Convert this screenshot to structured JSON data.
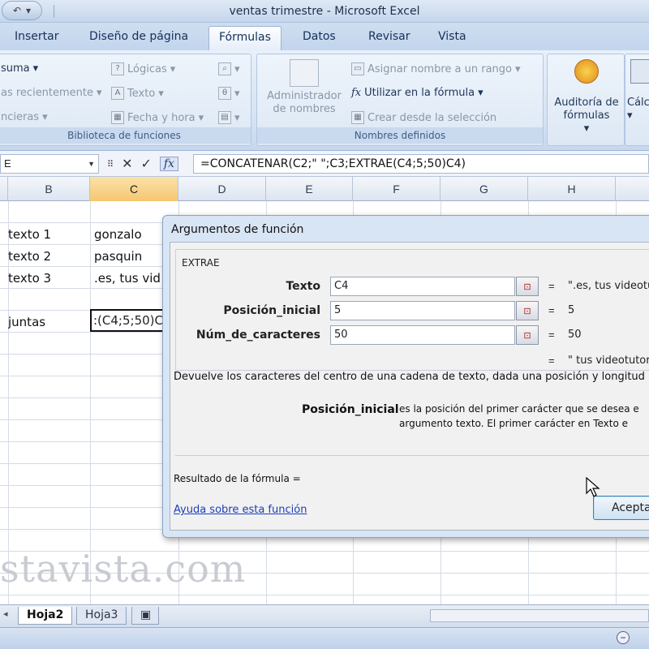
{
  "window": {
    "title": "ventas trimestre - Microsoft Excel"
  },
  "ribbon_tabs": [
    "Insertar",
    "Diseño de página",
    "Fórmulas",
    "Datos",
    "Revisar",
    "Vista"
  ],
  "ribbon": {
    "biblioteca": {
      "items_left": [
        "suma",
        "as recientemente",
        "ncieras"
      ],
      "items_mid": [
        "Lógicas",
        "Texto",
        "Fecha y hora"
      ],
      "label": "Biblioteca de funciones"
    },
    "nombres": {
      "admin": "Administrador de nombres",
      "asignar": "Asignar nombre a un rango",
      "utilizar": "Utilizar en la fórmula",
      "crear": "Crear desde la selección",
      "label": "Nombres definidos"
    },
    "auditoria": "Auditoría de fórmulas",
    "calculo": "Cálc"
  },
  "formula_bar": {
    "name_box": "E",
    "formula": "=CONCATENAR(C2;\" \";C3;EXTRAE(C4;5;50)C4)"
  },
  "columns": [
    "B",
    "C",
    "D",
    "E",
    "F",
    "G",
    "H"
  ],
  "cells": {
    "b2": "texto 1",
    "c2": "gonzalo",
    "b3": "texto 2",
    "c3": "pasquin",
    "b4": "texto 3",
    "c4": ".es, tus vid",
    "b6": "juntas",
    "c6": ":(C4;5;50)C"
  },
  "watermark": "stavista.com",
  "sheet_tabs": [
    "Hoja2",
    "Hoja3"
  ],
  "dialog": {
    "title": "Argumentos de función",
    "function_name": "EXTRAE",
    "args": [
      {
        "label": "Texto",
        "value": "C4",
        "result": "\".es, tus videotuto"
      },
      {
        "label": "Posición_inicial",
        "value": "5",
        "result": "5"
      },
      {
        "label": "Núm_de_caracteres",
        "value": "50",
        "result": "50"
      }
    ],
    "overall_result": "\" tus videotutoria",
    "description": "Devuelve los caracteres del centro de una cadena de texto, dada una posición y longitud i",
    "param_name": "Posición_inicial",
    "param_desc_1": "es la posición del primer carácter que se desea e",
    "param_desc_2": "argumento texto. El primer carácter en Texto e",
    "formula_result_label": "Resultado de la fórmula =",
    "help_link": "Ayuda sobre esta función",
    "ok_label": "Aceptar"
  },
  "colors": {
    "accent": "#c2d5ed",
    "selected_col": "#f5c770",
    "link": "#1a3fb8"
  }
}
